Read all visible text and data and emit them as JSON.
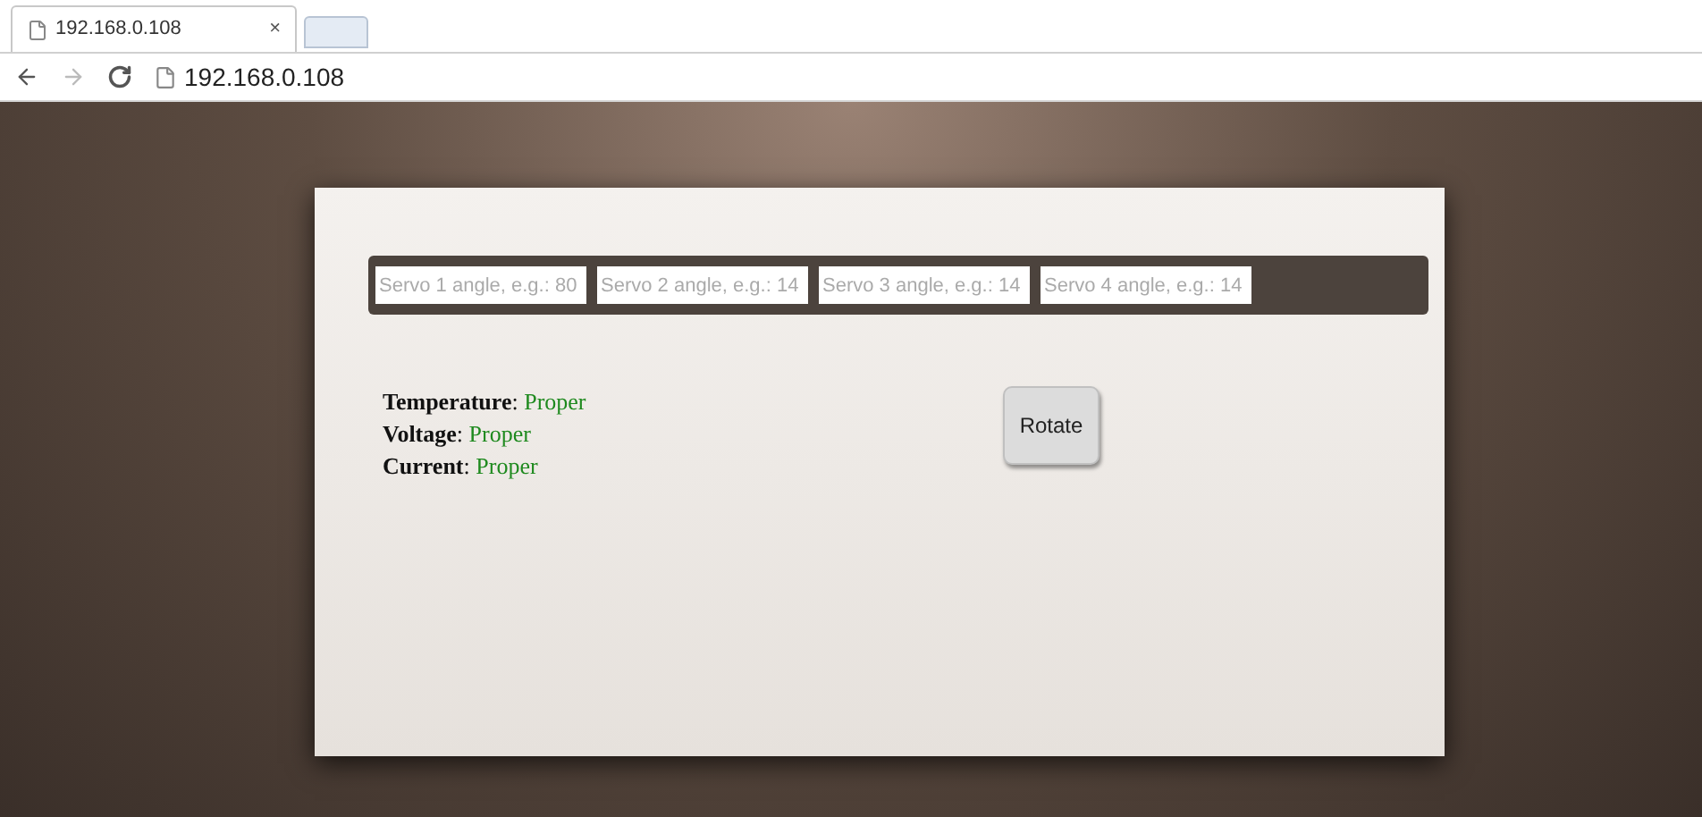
{
  "browser": {
    "tab_title": "192.168.0.108",
    "tab_close": "×",
    "address": "192.168.0.108"
  },
  "servo_inputs": [
    {
      "placeholder": "Servo 1 angle, e.g.: 80"
    },
    {
      "placeholder": "Servo 2 angle, e.g.: 14"
    },
    {
      "placeholder": "Servo 3 angle, e.g.: 14"
    },
    {
      "placeholder": "Servo 4 angle, e.g.: 14"
    }
  ],
  "status": [
    {
      "label": "**Temperature**:",
      "value": "Proper"
    },
    {
      "label": "**Voltage**:",
      "value": "Proper"
    },
    {
      "label": "**Current**:",
      "value": "Proper"
    }
  ],
  "rotate_button": "Rotate"
}
